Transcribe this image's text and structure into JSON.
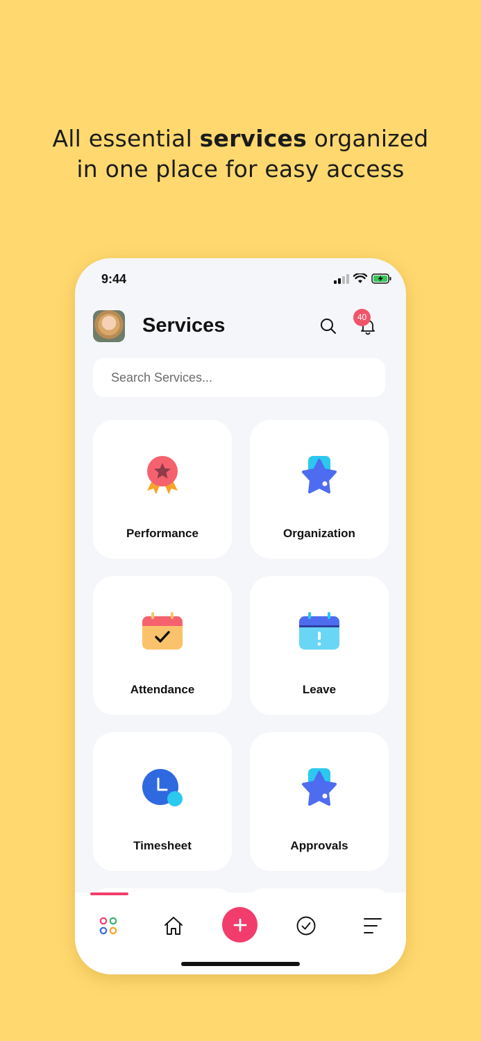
{
  "headline": {
    "part1": "All essential ",
    "bold": "services",
    "part2": " organized",
    "line2": "in one place for easy access"
  },
  "status_bar": {
    "time": "9:44"
  },
  "header": {
    "title": "Services",
    "notification_count": "40"
  },
  "search": {
    "placeholder": "Search Services..."
  },
  "services": [
    {
      "label": "Performance",
      "icon": "award-badge-icon"
    },
    {
      "label": "Organization",
      "icon": "star-icon"
    },
    {
      "label": "Attendance",
      "icon": "calendar-check-icon"
    },
    {
      "label": "Leave",
      "icon": "calendar-alert-icon"
    },
    {
      "label": "Timesheet",
      "icon": "clock-icon"
    },
    {
      "label": "Approvals",
      "icon": "star-icon"
    }
  ],
  "tabbar": {
    "items": [
      "apps-icon",
      "home-icon",
      "add-icon",
      "check-circle-icon",
      "menu-icon"
    ],
    "active": "apps-icon"
  },
  "colors": {
    "background": "#FFD96F",
    "accent": "#F23D6C",
    "badge": "#F0556A"
  }
}
